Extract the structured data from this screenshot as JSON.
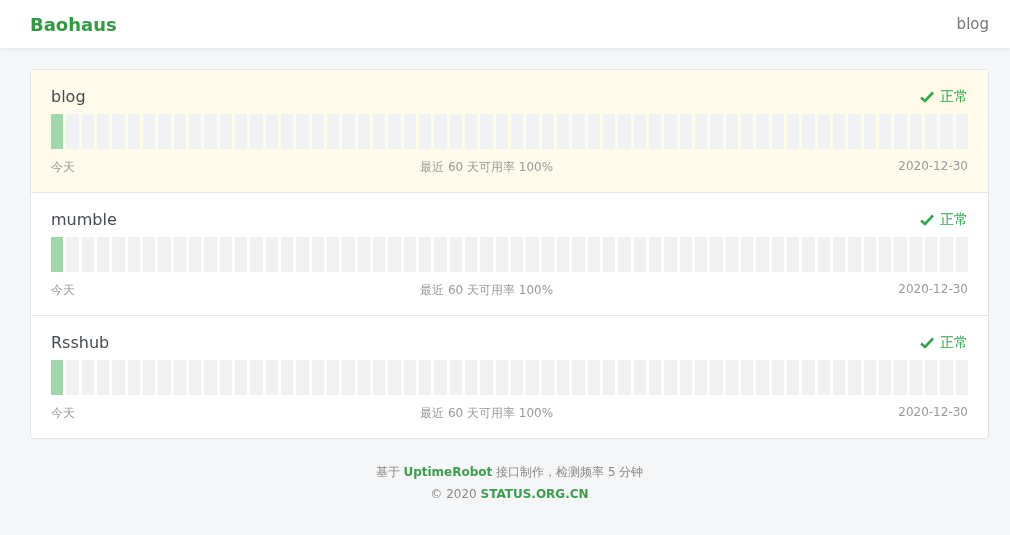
{
  "header": {
    "brand": "Baohaus",
    "nav": [
      "blog"
    ]
  },
  "monitors": [
    {
      "name": "blog",
      "highlighted": true,
      "status": {
        "kind": "ok",
        "label": "正常"
      },
      "days": [
        {
          "kind": "ok"
        },
        {
          "kind": "none"
        },
        {
          "kind": "none"
        },
        {
          "kind": "none"
        },
        {
          "kind": "none"
        },
        {
          "kind": "none"
        },
        {
          "kind": "none"
        },
        {
          "kind": "none"
        },
        {
          "kind": "none"
        },
        {
          "kind": "none"
        },
        {
          "kind": "none"
        },
        {
          "kind": "none"
        },
        {
          "kind": "none"
        },
        {
          "kind": "none"
        },
        {
          "kind": "none"
        },
        {
          "kind": "none"
        },
        {
          "kind": "none"
        },
        {
          "kind": "none"
        },
        {
          "kind": "none"
        },
        {
          "kind": "none"
        },
        {
          "kind": "none"
        },
        {
          "kind": "none"
        },
        {
          "kind": "none"
        },
        {
          "kind": "none"
        },
        {
          "kind": "none"
        },
        {
          "kind": "none"
        },
        {
          "kind": "none"
        },
        {
          "kind": "none"
        },
        {
          "kind": "none"
        },
        {
          "kind": "none"
        },
        {
          "kind": "none"
        },
        {
          "kind": "none"
        },
        {
          "kind": "none"
        },
        {
          "kind": "none"
        },
        {
          "kind": "none"
        },
        {
          "kind": "none"
        },
        {
          "kind": "none"
        },
        {
          "kind": "none"
        },
        {
          "kind": "none"
        },
        {
          "kind": "none"
        },
        {
          "kind": "none"
        },
        {
          "kind": "none"
        },
        {
          "kind": "none"
        },
        {
          "kind": "none"
        },
        {
          "kind": "none"
        },
        {
          "kind": "none"
        },
        {
          "kind": "none"
        },
        {
          "kind": "none"
        },
        {
          "kind": "none"
        },
        {
          "kind": "none"
        },
        {
          "kind": "none"
        },
        {
          "kind": "none"
        },
        {
          "kind": "none"
        },
        {
          "kind": "none"
        },
        {
          "kind": "none"
        },
        {
          "kind": "none"
        },
        {
          "kind": "none"
        },
        {
          "kind": "none"
        },
        {
          "kind": "none"
        },
        {
          "kind": "none"
        }
      ],
      "start": "今天",
      "uptime": "最近 60 天可用率 100%",
      "end": "2020-12-30"
    },
    {
      "name": "mumble",
      "highlighted": false,
      "status": {
        "kind": "ok",
        "label": "正常"
      },
      "days": [
        {
          "kind": "ok"
        },
        {
          "kind": "none"
        },
        {
          "kind": "none"
        },
        {
          "kind": "none"
        },
        {
          "kind": "none"
        },
        {
          "kind": "none"
        },
        {
          "kind": "none"
        },
        {
          "kind": "none"
        },
        {
          "kind": "none"
        },
        {
          "kind": "none"
        },
        {
          "kind": "none"
        },
        {
          "kind": "none"
        },
        {
          "kind": "none"
        },
        {
          "kind": "none"
        },
        {
          "kind": "none"
        },
        {
          "kind": "none"
        },
        {
          "kind": "none"
        },
        {
          "kind": "none"
        },
        {
          "kind": "none"
        },
        {
          "kind": "none"
        },
        {
          "kind": "none"
        },
        {
          "kind": "none"
        },
        {
          "kind": "none"
        },
        {
          "kind": "none"
        },
        {
          "kind": "none"
        },
        {
          "kind": "none"
        },
        {
          "kind": "none"
        },
        {
          "kind": "none"
        },
        {
          "kind": "none"
        },
        {
          "kind": "none"
        },
        {
          "kind": "none"
        },
        {
          "kind": "none"
        },
        {
          "kind": "none"
        },
        {
          "kind": "none"
        },
        {
          "kind": "none"
        },
        {
          "kind": "none"
        },
        {
          "kind": "none"
        },
        {
          "kind": "none"
        },
        {
          "kind": "none"
        },
        {
          "kind": "none"
        },
        {
          "kind": "none"
        },
        {
          "kind": "none"
        },
        {
          "kind": "none"
        },
        {
          "kind": "none"
        },
        {
          "kind": "none"
        },
        {
          "kind": "none"
        },
        {
          "kind": "none"
        },
        {
          "kind": "none"
        },
        {
          "kind": "none"
        },
        {
          "kind": "none"
        },
        {
          "kind": "none"
        },
        {
          "kind": "none"
        },
        {
          "kind": "none"
        },
        {
          "kind": "none"
        },
        {
          "kind": "none"
        },
        {
          "kind": "none"
        },
        {
          "kind": "none"
        },
        {
          "kind": "none"
        },
        {
          "kind": "none"
        },
        {
          "kind": "none"
        }
      ],
      "start": "今天",
      "uptime": "最近 60 天可用率 100%",
      "end": "2020-12-30"
    },
    {
      "name": "Rsshub",
      "highlighted": false,
      "status": {
        "kind": "ok",
        "label": "正常"
      },
      "days": [
        {
          "kind": "ok"
        },
        {
          "kind": "none"
        },
        {
          "kind": "none"
        },
        {
          "kind": "none"
        },
        {
          "kind": "none"
        },
        {
          "kind": "none"
        },
        {
          "kind": "none"
        },
        {
          "kind": "none"
        },
        {
          "kind": "none"
        },
        {
          "kind": "none"
        },
        {
          "kind": "none"
        },
        {
          "kind": "none"
        },
        {
          "kind": "none"
        },
        {
          "kind": "none"
        },
        {
          "kind": "none"
        },
        {
          "kind": "none"
        },
        {
          "kind": "none"
        },
        {
          "kind": "none"
        },
        {
          "kind": "none"
        },
        {
          "kind": "none"
        },
        {
          "kind": "none"
        },
        {
          "kind": "none"
        },
        {
          "kind": "none"
        },
        {
          "kind": "none"
        },
        {
          "kind": "none"
        },
        {
          "kind": "none"
        },
        {
          "kind": "none"
        },
        {
          "kind": "none"
        },
        {
          "kind": "none"
        },
        {
          "kind": "none"
        },
        {
          "kind": "none"
        },
        {
          "kind": "none"
        },
        {
          "kind": "none"
        },
        {
          "kind": "none"
        },
        {
          "kind": "none"
        },
        {
          "kind": "none"
        },
        {
          "kind": "none"
        },
        {
          "kind": "none"
        },
        {
          "kind": "none"
        },
        {
          "kind": "none"
        },
        {
          "kind": "none"
        },
        {
          "kind": "none"
        },
        {
          "kind": "none"
        },
        {
          "kind": "none"
        },
        {
          "kind": "none"
        },
        {
          "kind": "none"
        },
        {
          "kind": "none"
        },
        {
          "kind": "none"
        },
        {
          "kind": "none"
        },
        {
          "kind": "none"
        },
        {
          "kind": "none"
        },
        {
          "kind": "none"
        },
        {
          "kind": "none"
        },
        {
          "kind": "none"
        },
        {
          "kind": "none"
        },
        {
          "kind": "none"
        },
        {
          "kind": "none"
        },
        {
          "kind": "none"
        },
        {
          "kind": "none"
        },
        {
          "kind": "none"
        }
      ],
      "start": "今天",
      "uptime": "最近 60 天可用率 100%",
      "end": "2020-12-30"
    }
  ],
  "footer": [
    {
      "before": "基于 ",
      "link": "UptimeRobot",
      "after": " 接口制作，检测频率 5 分钟"
    },
    {
      "before": "© 2020 ",
      "link": "STATUS.ORG.CN"
    }
  ]
}
